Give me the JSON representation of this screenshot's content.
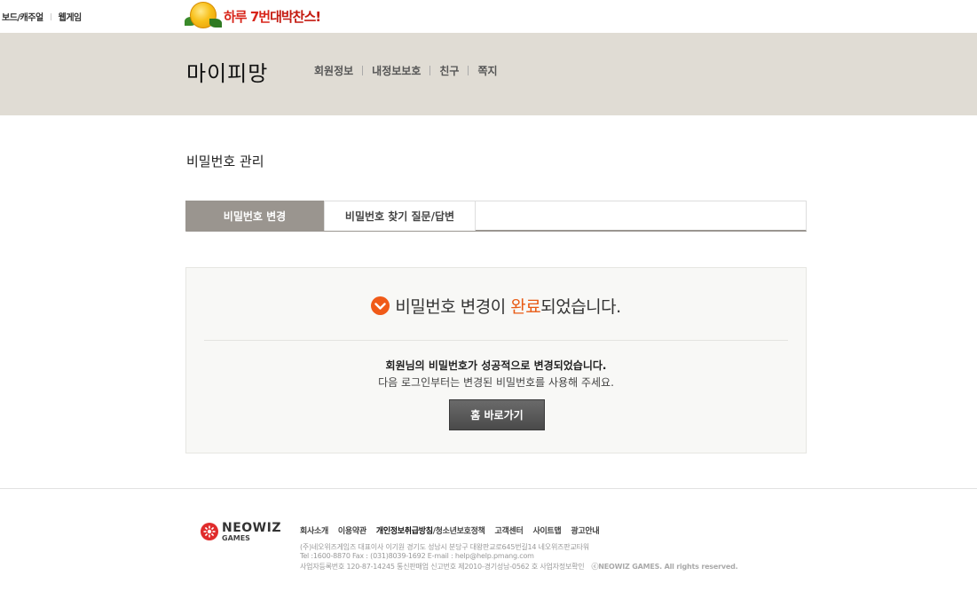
{
  "topbar": {
    "links": [
      "보드/캐주얼",
      "웹게임"
    ],
    "promo_text_1": "하루 7번",
    "promo_text_2": "대박찬스!"
  },
  "header": {
    "title": "마이피망",
    "nav": [
      "회원정보",
      "내정보보호",
      "친구",
      "쪽지"
    ]
  },
  "main": {
    "page_title": "비밀번호 관리",
    "tabs": [
      {
        "label": "비밀번호 변경",
        "active": true
      },
      {
        "label": "비밀번호 찾기 질문/답변",
        "active": false
      }
    ],
    "result": {
      "title_before": "비밀번호 변경이 ",
      "title_highlight": "완료",
      "title_after": "되었습니다.",
      "message_bold": "회원님의 비밀번호가 성공적으로 변경되었습니다.",
      "message": "다음 로그인부터는 변경된 비밀번호를 사용해 주세요.",
      "home_button": "홈 바로가기"
    }
  },
  "footer": {
    "logo_line1": "NEOWIZ",
    "logo_line2": "GAMES",
    "nav": [
      "회사소개",
      "이용약관",
      "개인정보취급방침",
      "/청소년보호정책",
      "고객센터",
      "사이트맵",
      "광고안내"
    ],
    "info_line1": "(주)네오위즈게임즈    대표이사 이기원    경기도 성남시 분당구 대왕판교로645번길14 네오위즈판교타워",
    "info_line2": "Tel :1600-8870 Fax : (031)8039-1692  E-mail : help@help.pmang.com",
    "info_line3": "사업자등록번호 120-87-14245 통신판매업 신고번호  제2010-경기성남-0562 호  사업자정보확인",
    "copyright": "ⓒNEOWIZ GAMES. All rights reserved."
  },
  "colors": {
    "band_bg": "#e0dcd4",
    "active_tab": "#9a958f",
    "accent": "#e85a14",
    "button": "#4a4a4a"
  }
}
